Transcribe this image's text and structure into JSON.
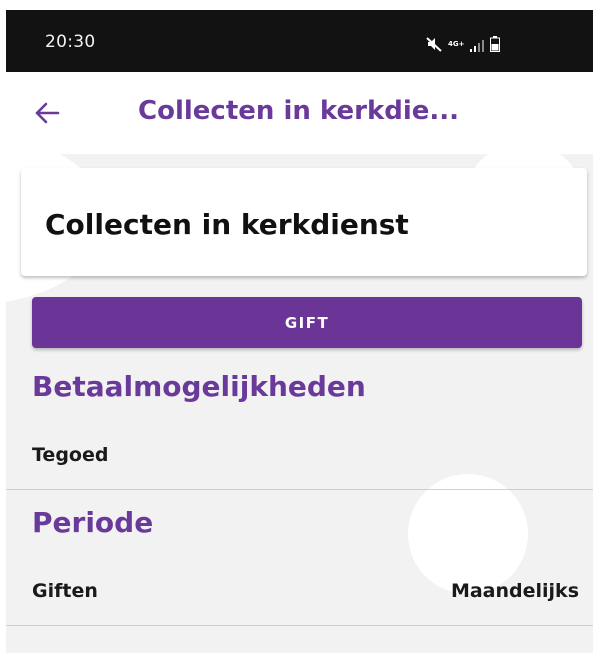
{
  "status_bar": {
    "time": "20:30",
    "network": "4G+",
    "icons": [
      "mute-icon",
      "signal-icon",
      "battery-icon"
    ]
  },
  "app_bar": {
    "back_icon": "arrow-left-icon",
    "title": "Collecten in kerkdie..."
  },
  "card": {
    "title": "Collecten in kerkdienst"
  },
  "gift_button": {
    "label": "GIFT"
  },
  "sections": {
    "payment": {
      "heading": "Betaalmogelijkheden",
      "row_label": "Tegoed"
    },
    "period": {
      "heading": "Periode",
      "row_label": "Giften",
      "row_value": "Maandelijks"
    }
  },
  "colors": {
    "accent": "#6a3a9b",
    "button": "#6a3597",
    "status_bar": "#121212",
    "content_bg": "#f2f2f2"
  }
}
